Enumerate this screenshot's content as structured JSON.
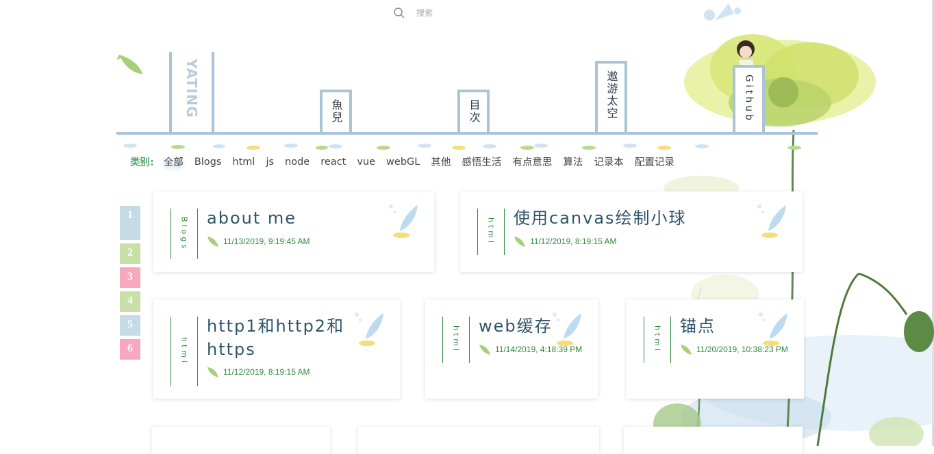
{
  "search": {
    "placeholder": "搜索"
  },
  "nav": {
    "logo": "YATING",
    "tabs": [
      "魚兒",
      "目次",
      "遨游太空",
      "Github"
    ]
  },
  "categories": {
    "label": "类别:",
    "items": [
      "全部",
      "Blogs",
      "html",
      "js",
      "node",
      "react",
      "vue",
      "webGL",
      "其他",
      "感悟生活",
      "有点意思",
      "算法",
      "记录本",
      "配置记录"
    ],
    "active": "全部"
  },
  "pager": {
    "pages": [
      "1",
      "2",
      "3",
      "4",
      "5",
      "6"
    ],
    "colors": [
      "#c5dce6",
      "#c8e0a8",
      "#f7a8bf",
      "#c8e0a8",
      "#c5dce6",
      "#f7a8bf"
    ],
    "current": "1"
  },
  "posts": [
    {
      "category": "Blogs",
      "title": "about me",
      "date": "11/13/2019, 9:19:45 AM"
    },
    {
      "category": "html",
      "title": "使用canvas绘制小球",
      "date": "11/12/2019, 8:19:15 AM"
    },
    {
      "category": "html",
      "title": "http1和http2和https",
      "date": "11/12/2019, 8:19:15 AM"
    },
    {
      "category": "html",
      "title": "web缓存",
      "date": "11/14/2019, 4:18:39 PM"
    },
    {
      "category": "html",
      "title": "锚点",
      "date": "11/20/2019, 10:38:23 PM"
    }
  ],
  "colors": {
    "shelf": "#a8c4d6",
    "accent_green": "#2e8a3a",
    "title": "#2f5468"
  }
}
